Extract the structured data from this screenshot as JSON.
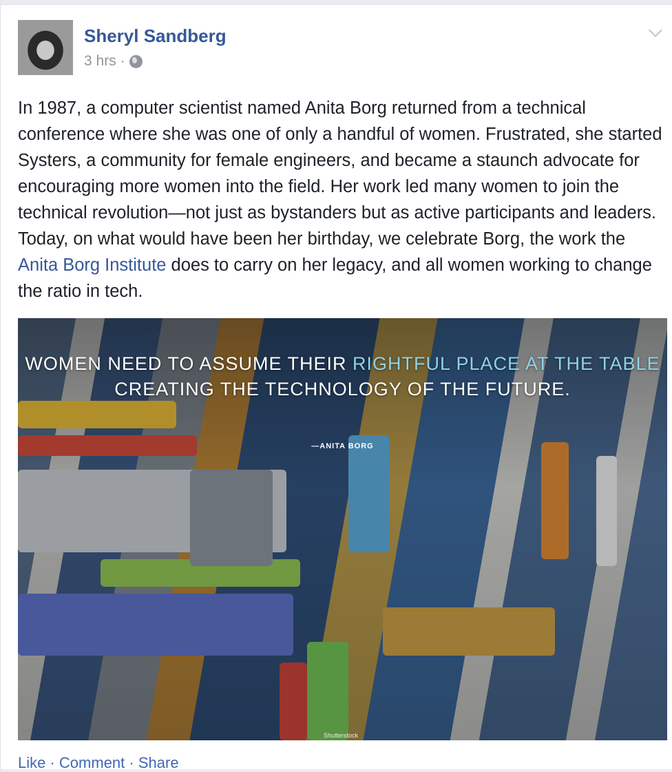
{
  "post": {
    "author": "Sheryl Sandberg",
    "time": "3 hrs",
    "separator": "·",
    "privacy_icon": "globe-icon",
    "text_before_link": "In 1987, a computer scientist named Anita Borg returned from a technical conference where she was one of only a handful of women. Frustrated, she started Systers, a community for female engineers, and became a staunch advocate for encouraging more women into the field. Her work led many women to join the technical revolution—not just as bystanders but as active participants and leaders. Today, on what would have been her birthday, we celebrate Borg, the work the ",
    "link_text": "Anita Borg Institute",
    "text_after_link": " does to carry on her legacy, and all women working to change the ratio in tech.",
    "image": {
      "quote_part1": "WOMEN NEED TO ASSUME THEIR ",
      "quote_highlight1": "RIGHTFUL PLACE AT THE TABLE",
      "quote_part2": " CREATING THE TECHNOLOGY OF THE FUTURE.",
      "attribution": "—ANITA BORG",
      "credit": "Shutterstock"
    },
    "actions": {
      "like": "Like",
      "comment": "Comment",
      "share": "Share",
      "sep": " · "
    }
  },
  "colors": {
    "link": "#365899",
    "meta": "#90949c",
    "text": "#1d2129",
    "action": "#4267b2"
  }
}
